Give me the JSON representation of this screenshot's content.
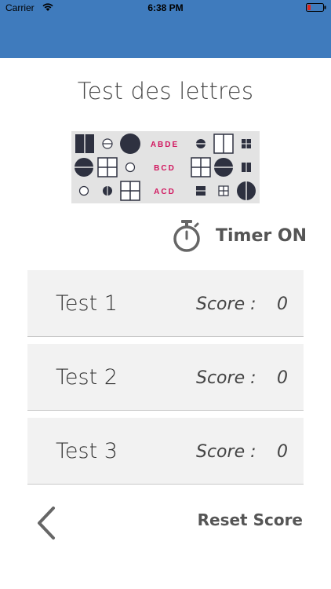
{
  "status_bar": {
    "carrier": "Carrier",
    "time": "6:38 PM",
    "wifi_icon": "wifi-icon",
    "battery_icon": "battery-icon",
    "header_color": "#3f7bbd"
  },
  "page": {
    "title": "Test des lettres"
  },
  "logo": {
    "row1_letters": "ABDE",
    "row2_letters": "BCD",
    "row3_letters": "ACD",
    "letter_color": "#d1155e",
    "background_color": "#e3e3e3"
  },
  "timer": {
    "icon": "stopwatch-icon",
    "label": "Timer ON"
  },
  "tests": [
    {
      "name": "Test 1",
      "score_label": "Score :",
      "score": "0"
    },
    {
      "name": "Test 2",
      "score_label": "Score :",
      "score": "0"
    },
    {
      "name": "Test 3",
      "score_label": "Score :",
      "score": "0"
    }
  ],
  "footer": {
    "back_icon": "chevron-left-icon",
    "reset_label": "Reset Score"
  }
}
